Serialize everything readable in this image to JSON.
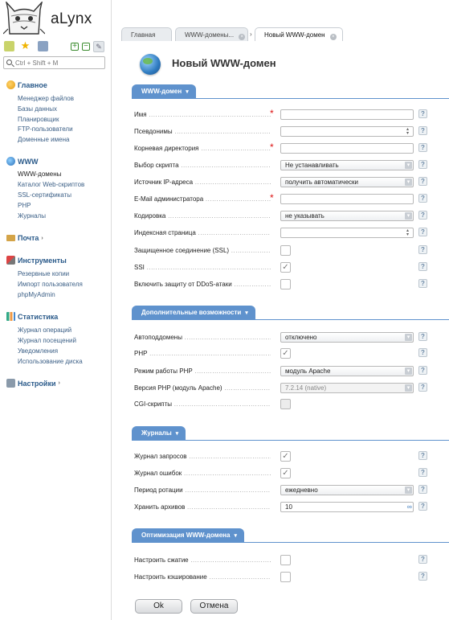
{
  "app": {
    "name": "aLynx"
  },
  "search": {
    "placeholder": "Ctrl + Shift + M"
  },
  "sidebar": {
    "sections": [
      {
        "title": "Главное",
        "items": [
          "Менеджер файлов",
          "Базы данных",
          "Планировщик",
          "FTP-пользователи",
          "Доменные имена"
        ]
      },
      {
        "title": "WWW",
        "items": [
          "WWW-домены",
          "Каталог Web-скриптов",
          "SSL-сертификаты",
          "PHP",
          "Журналы"
        ]
      },
      {
        "title": "Почта",
        "items": []
      },
      {
        "title": "Инструменты",
        "items": [
          "Резервные копии",
          "Импорт пользователя",
          "phpMyAdmin"
        ]
      },
      {
        "title": "Статистика",
        "items": [
          "Журнал операций",
          "Журнал посещений",
          "Уведомления",
          "Использование диска"
        ]
      },
      {
        "title": "Настройки",
        "items": []
      }
    ]
  },
  "tabs": [
    {
      "label": "Главная"
    },
    {
      "label": "WWW-домены..."
    },
    {
      "label": "Новый WWW-домен"
    }
  ],
  "page": {
    "title": "Новый WWW-домен"
  },
  "groups": {
    "www": {
      "title": "WWW-домен",
      "fields": {
        "name": {
          "label": "Имя",
          "value": ""
        },
        "aliases": {
          "label": "Псевдонимы",
          "value": ""
        },
        "root": {
          "label": "Корневая директория",
          "value": ""
        },
        "script": {
          "label": "Выбор скрипта",
          "value": "Не устанавливать"
        },
        "ip": {
          "label": "Источник IP-адреса",
          "value": "получить автоматически"
        },
        "email": {
          "label": "E-Mail администратора",
          "value": ""
        },
        "charset": {
          "label": "Кодировка",
          "value": "не указывать"
        },
        "index": {
          "label": "Индексная страница",
          "value": ""
        },
        "secure": {
          "label": "Защищенное соединение (SSL)",
          "checked": false
        },
        "ssi": {
          "label": "SSI",
          "checked": true
        },
        "ddos": {
          "label": "Включить защиту от DDoS-атаки",
          "checked": false
        }
      }
    },
    "extra": {
      "title": "Дополнительные возможности",
      "fields": {
        "autosub": {
          "label": "Автоподдомены",
          "value": "отключено"
        },
        "php": {
          "label": "PHP",
          "checked": true
        },
        "phpmode": {
          "label": "Режим работы PHP",
          "value": "модуль Apache"
        },
        "phpver": {
          "label": "Версия PHP (модуль Apache)",
          "value": "7.2.14 (native)"
        },
        "cgi": {
          "label": "CGI-скрипты",
          "checked": false
        }
      }
    },
    "logs": {
      "title": "Журналы",
      "fields": {
        "access": {
          "label": "Журнал запросов",
          "checked": true
        },
        "error": {
          "label": "Журнал ошибок",
          "checked": true
        },
        "rotate": {
          "label": "Период ротации",
          "value": "ежедневно"
        },
        "keep": {
          "label": "Хранить архивов",
          "value": "10"
        }
      }
    },
    "optim": {
      "title": "Оптимизация WWW-домена",
      "fields": {
        "compress": {
          "label": "Настроить сжатие",
          "checked": false
        },
        "cache": {
          "label": "Настроить кэширование",
          "checked": false
        }
      }
    }
  },
  "buttons": {
    "ok": "Ok",
    "cancel": "Отмена"
  },
  "glyphs": {
    "help": "?",
    "required": "*",
    "check": "✓",
    "close": "×",
    "nav_arrow": "›",
    "dropdown": "▾",
    "infinity": "∞"
  },
  "colors": {
    "accent": "#5f92cd",
    "link": "#3b5f86",
    "required": "#dd1111"
  }
}
